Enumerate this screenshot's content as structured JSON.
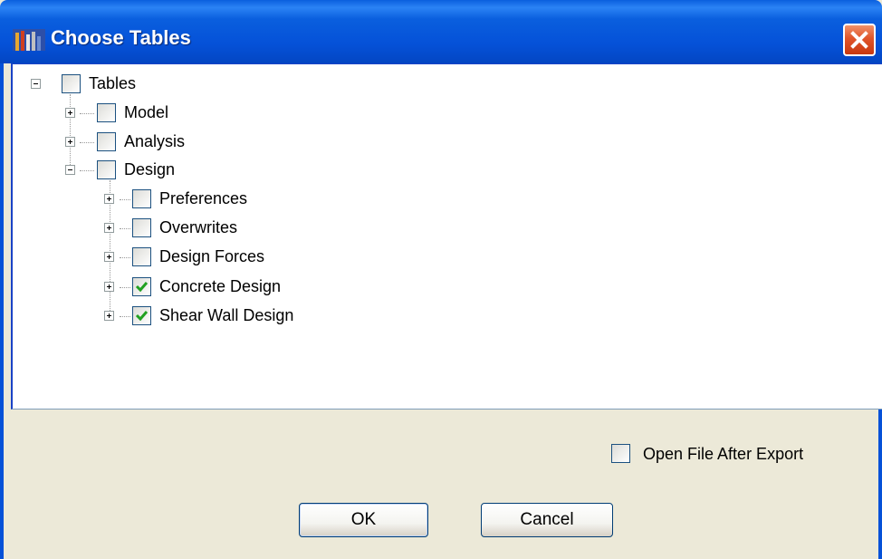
{
  "window": {
    "title": "Choose Tables"
  },
  "colors": {
    "titlebar": "#0551d8",
    "close": "#e0542a",
    "check": "#21a121",
    "panel": "#ece9d8"
  },
  "tree": {
    "root": {
      "label": "Tables",
      "checked": false,
      "expanded": true
    },
    "children": [
      {
        "label": "Model",
        "checked": false,
        "expanded": false
      },
      {
        "label": "Analysis",
        "checked": false,
        "expanded": false
      },
      {
        "label": "Design",
        "checked": false,
        "expanded": true
      }
    ],
    "design_children": [
      {
        "label": "Preferences",
        "checked": false,
        "expanded": false
      },
      {
        "label": "Overwrites",
        "checked": false,
        "expanded": false
      },
      {
        "label": "Design Forces",
        "checked": false,
        "expanded": false
      },
      {
        "label": "Concrete Design",
        "checked": true,
        "expanded": false
      },
      {
        "label": "Shear Wall Design",
        "checked": true,
        "expanded": false
      }
    ]
  },
  "options": {
    "open_after_export_label": "Open File After Export",
    "open_after_export_checked": false
  },
  "buttons": {
    "ok": "OK",
    "cancel": "Cancel"
  },
  "icons": {
    "title": "app-icon",
    "close": "close-icon",
    "expand": "plus-box-icon",
    "collapse": "minus-box-icon",
    "check": "checkmark-icon"
  }
}
